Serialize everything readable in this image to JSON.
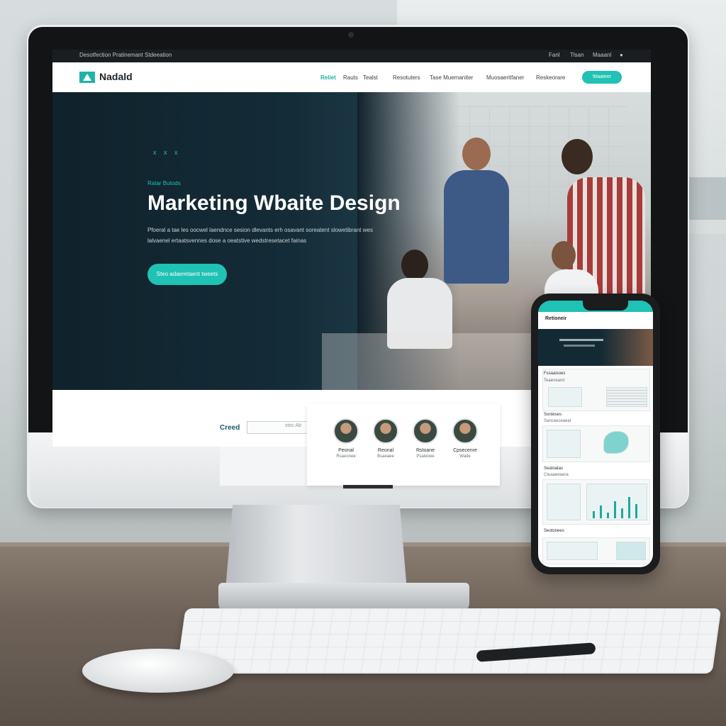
{
  "site": {
    "topbar": {
      "left_text": "Desotfection Pratinemant Stdeeation",
      "right_links": [
        "Fanl",
        "Tlsan",
        "Maaanl"
      ]
    },
    "nav": {
      "logo": "Nadald",
      "items": [
        "Reliet",
        "Rauts",
        "Tealst",
        "Resotuters",
        "Tase Muemaniter",
        "Muosaeritfaner",
        "Reskeorare"
      ],
      "cta": "Waateer"
    },
    "hero": {
      "dots": "x x x",
      "eyebrow": "Ratar Butods",
      "title": "Marketing Wbaite Design",
      "body_line1": "Pfoeral a tae les oocwel laendnce sesion dlevants erh osavant soreatent slowetibrant wes",
      "body_line2": "lalvaenel ertaatsvennes dose a oeatstive wedstresetacet fainas",
      "cta": "Steo adaeretaent tweets"
    },
    "below": {
      "label": "Creed",
      "input_value": "stoc Ab"
    },
    "team": [
      {
        "name": "Peonal",
        "role": "Rsaeonee"
      },
      {
        "name": "Reonal",
        "role": "Bsaeaee"
      },
      {
        "name": "Rstoane",
        "role": "Psateoee"
      },
      {
        "name": "Cpsecenre",
        "role": "Wade"
      }
    ]
  },
  "phone": {
    "logo": "Retioneir",
    "sections": [
      "Fssaaisoes",
      "Sonteses",
      "Seatoatas",
      "Seotonees"
    ],
    "sub_labels": [
      "Teaeneanir",
      "Sanceeseaeal",
      "Cteaaeeaera"
    ]
  },
  "colors": {
    "accent": "#1fc2b4",
    "hero_dark": "#10222c",
    "topbar": "#1b1e21"
  }
}
